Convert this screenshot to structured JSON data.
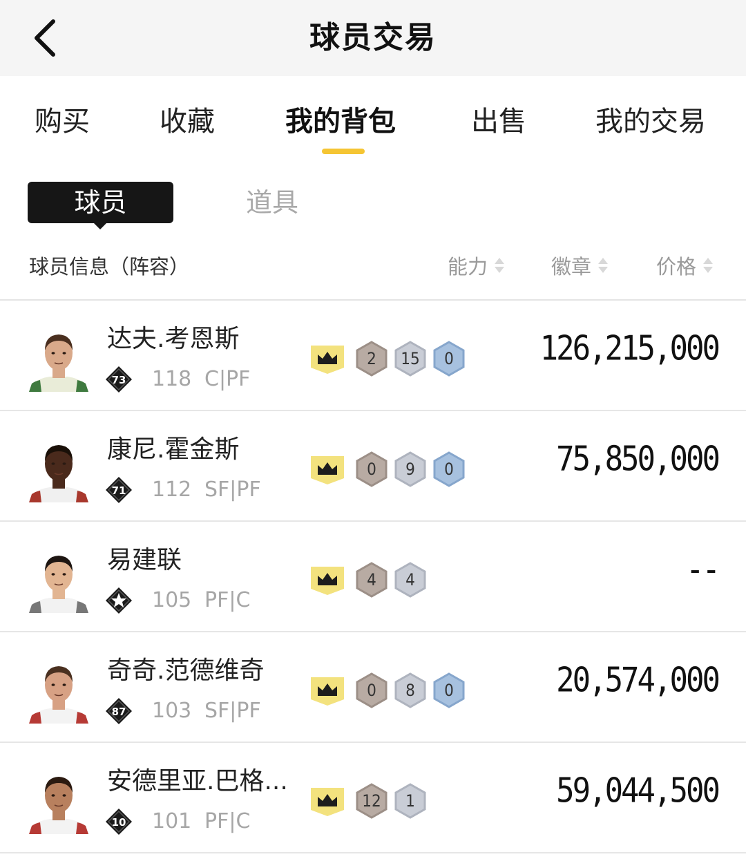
{
  "header": {
    "title": "球员交易"
  },
  "tabs": [
    {
      "label": "购买"
    },
    {
      "label": "收藏"
    },
    {
      "label": "我的背包"
    },
    {
      "label": "出售"
    },
    {
      "label": "我的交易"
    }
  ],
  "subtabs": {
    "active": "球员",
    "other": "道具"
  },
  "columns": {
    "info": "球员信息（阵容）",
    "ability": "能力",
    "badge": "徽章",
    "price": "价格"
  },
  "colors": {
    "accent": "#f5c533",
    "dark": "#161616"
  },
  "players": [
    {
      "name": "达夫.考恩斯",
      "rank": "73",
      "overall": "118",
      "position": "C|PF",
      "badges": [
        "2",
        "15",
        "0"
      ],
      "price": "126,215,000"
    },
    {
      "name": "康尼.霍金斯",
      "rank": "71",
      "overall": "112",
      "position": "SF|PF",
      "badges": [
        "0",
        "9",
        "0"
      ],
      "price": "75,850,000"
    },
    {
      "name": "易建联",
      "rank": "",
      "overall": "105",
      "position": "PF|C",
      "badges": [
        "4",
        "4"
      ],
      "price": "--"
    },
    {
      "name": "奇奇.范德维奇",
      "rank": "87",
      "overall": "103",
      "position": "SF|PF",
      "badges": [
        "0",
        "8",
        "0"
      ],
      "price": "20,574,000"
    },
    {
      "name": "安德里亚.巴格...",
      "rank": "10",
      "overall": "101",
      "position": "PF|C",
      "badges": [
        "12",
        "1"
      ],
      "price": "59,044,500"
    }
  ]
}
